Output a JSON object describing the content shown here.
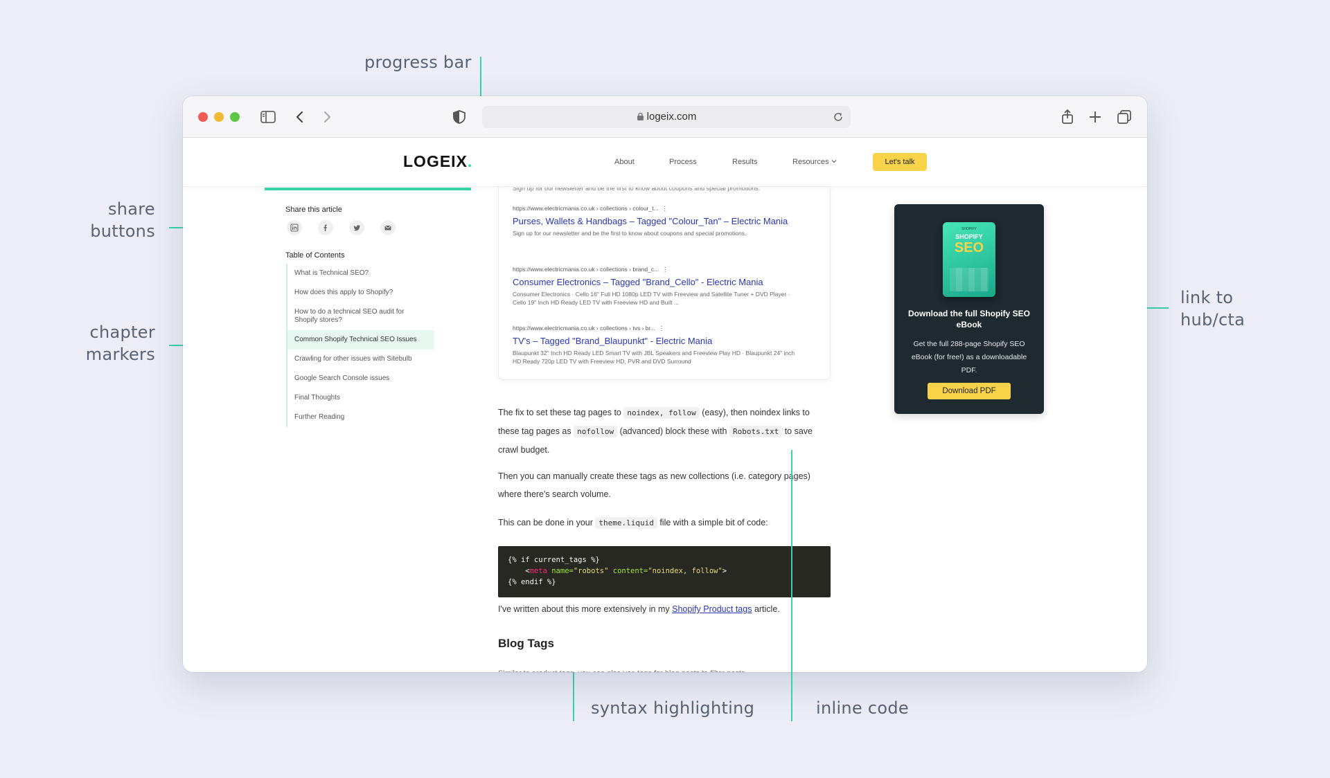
{
  "annotations": {
    "progress_bar": "progress bar",
    "share_buttons_line1": "share",
    "share_buttons_line2": "buttons",
    "chapter_markers_line1": "chapter",
    "chapter_markers_line2": "markers",
    "link_cta_line1": "link to",
    "link_cta_line2": "hub/cta",
    "syntax_highlighting": "syntax highlighting",
    "inline_code": "inline code",
    "accent_color": "#35d3a6"
  },
  "browser": {
    "url": "logeix.com",
    "icons": [
      "sidebar-icon",
      "back-icon",
      "forward-icon",
      "shield-icon",
      "lock-icon",
      "reload-icon",
      "share-icon",
      "new-tab-icon",
      "tabs-icon"
    ]
  },
  "site": {
    "logo": "LOGEIX",
    "logo_dot": ".",
    "nav": [
      "About",
      "Process",
      "Results",
      "Resources"
    ],
    "cta": "Let's talk",
    "cta_color": "#f8d34a",
    "reading_progress": 0.25
  },
  "sidebar": {
    "share_title": "Share this article",
    "share_icons": [
      "linkedin-icon",
      "facebook-icon",
      "twitter-icon",
      "email-icon"
    ],
    "toc_title": "Table of Contents",
    "toc": [
      "What is Technical SEO?",
      "How does this apply to Shopify?",
      "How to do a technical SEO audit for Shopify stores?",
      "Common Shopify Technical SEO Issues",
      "Crawling for other issues with Sitebulb",
      "Google Search Console issues",
      "Final Thoughts",
      "Further Reading"
    ],
    "toc_active_index": 3
  },
  "results": {
    "cut_top": "Sign up for our newsletter and be the first to know about coupons and special promotions.",
    "items": [
      {
        "url": "https://www.electricmania.co.uk › collections › colour_t...",
        "title": "Purses, Wallets & Handbags – Tagged \"Colour_Tan\" – Electric Mania",
        "desc": "Sign up for our newsletter and be the first to know about coupons and special promotions."
      },
      {
        "url": "https://www.electricmania.co.uk › collections › brand_c...",
        "title": "Consumer Electronics – Tagged \"Brand_Cello\" - Electric Mania",
        "desc": "Consumer Electronics · Cello 16\" Full HD 1080p LED TV with Freeview and Satellite Tuner + DVD Player · Cello 19\" Inch HD Ready LED TV with Freeview HD and Built ..."
      },
      {
        "url": "https://www.electricmania.co.uk › collections › tvs › br...",
        "title": "TV's – Tagged \"Brand_Blaupunkt\" - Electric Mania",
        "desc": "Blaupunkt 32\" Inch HD Ready LED Smart TV with JBL Speakers and Freeview Play HD · Blaupunkt 24\" inch HD Ready 720p LED TV with Freeview HD, PVR and DVD Surround"
      }
    ]
  },
  "article": {
    "p1_a": "The fix to set these tag pages to ",
    "p1_code1": "noindex, follow",
    "p1_b": " (easy), then noindex links to these tag pages as ",
    "p1_code2": "nofollow",
    "p1_c": " (advanced) block these with ",
    "p1_code3": "Robots.txt",
    "p1_d": " to save crawl budget.",
    "p2": "Then you can manually create these tags as new collections (i.e. category pages) where there's search volume.",
    "p3_a": "This can be done in your ",
    "p3_code": "theme.liquid",
    "p3_b": " file with a simple bit of code:",
    "code": {
      "line1": "{% if current_tags %}",
      "line2_indent": "    <",
      "line2_tag": "meta",
      "line2_attr1": "name=",
      "line2_val1": "\"robots\"",
      "line2_attr2": "content=",
      "line2_val2": "\"noindex, follow\"",
      "line2_end": ">",
      "line3": "{% endif %}"
    },
    "p4_a": "I've written about this more extensively in my ",
    "p4_link": "Shopify Product tags",
    "p4_b": " article.",
    "h_blog": "Blog Tags",
    "cut_bottom": "Similar to product tags, you can also use tags for blog posts to filter posts"
  },
  "ebook": {
    "cover_small": "SHOPIFY",
    "cover_word1": "SHOPIFY",
    "cover_word2": "SEO",
    "title": "Download the full Shopify SEO eBook",
    "desc": "Get the full 288-page Shopify SEO eBook (for free!) as a downloadable PDF.",
    "button": "Download PDF",
    "bg_color": "#1e2a30"
  }
}
